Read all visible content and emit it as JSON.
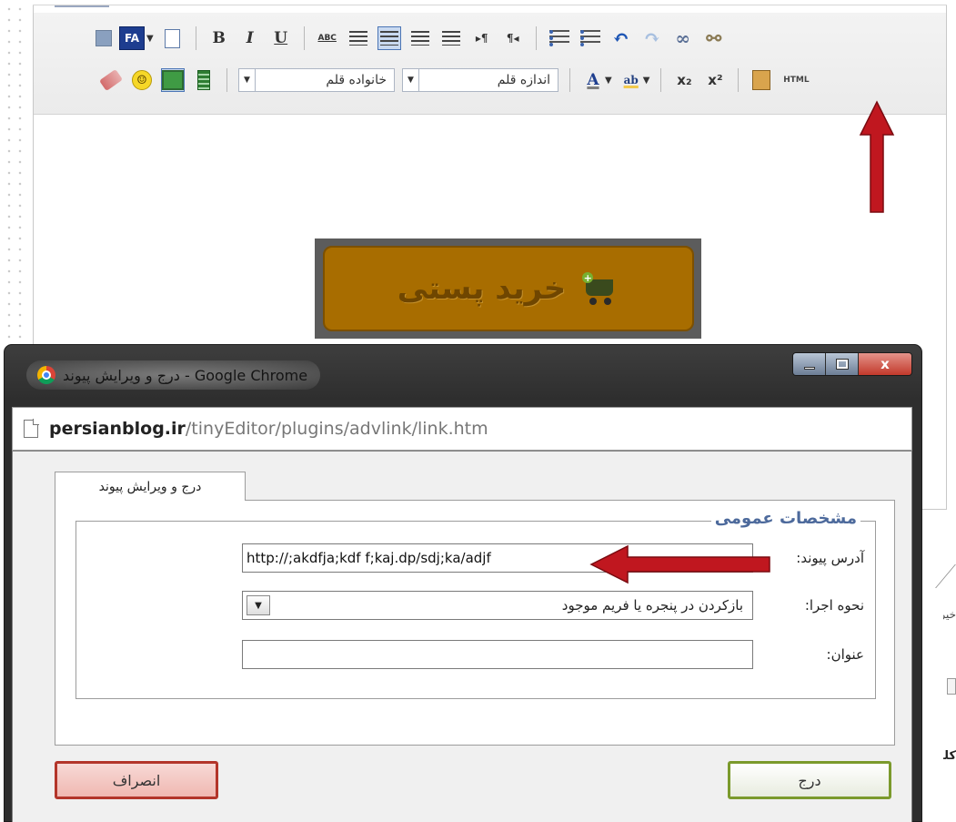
{
  "editor": {
    "toolbar_row1": {
      "fa_label": "FA",
      "bold": "B",
      "italic": "I",
      "underline": "U",
      "spellcheck": "ABC"
    },
    "toolbar_row2": {
      "font_family_label": "خانواده قلم",
      "font_size_label": "اندازه قلم",
      "font_color_glyph": "A",
      "highlight_glyph": "ab",
      "subscript": "x₂",
      "superscript": "x²",
      "html_label": "HTML"
    },
    "content_image_text": "خرید پستی",
    "side_texts": [
      "خیره",
      "کلم"
    ]
  },
  "popup": {
    "window_title": "درج و ویرایش پیوند - Google Chrome",
    "controls": {
      "close": "x"
    },
    "address": {
      "host": "persianblog.ir",
      "path": "/tinyEditor/plugins/advlink/link.htm"
    },
    "tab_label": "درج و ویرایش پیوند",
    "fieldset_legend": "مشخصات عمومی",
    "fields": {
      "url_label": "آدرس پیوند:",
      "url_value": "http://;akdfja;kdf f;kaj.dp/sdj;ka/adjf",
      "target_label": "نحوه اجرا:",
      "target_value": "بازکردن در پنجره یا فریم موجود",
      "title_label": "عنوان:",
      "title_value": ""
    },
    "buttons": {
      "insert": "درج",
      "cancel": "انصراف"
    }
  },
  "annotations": {
    "arrow_color": "#c0171f"
  },
  "icons": [
    "save-icon",
    "new-document-icon",
    "spellcheck-icon",
    "align-left-icon",
    "align-center-icon",
    "align-right-icon",
    "justify-icon",
    "ltr-icon",
    "rtl-icon",
    "bullet-list-icon",
    "number-list-icon",
    "undo-icon",
    "redo-icon",
    "link-icon",
    "unlink-icon",
    "cleanup-icon",
    "smiley-icon",
    "image-icon",
    "media-icon",
    "paste-icon",
    "chrome-icon",
    "page-icon"
  ]
}
